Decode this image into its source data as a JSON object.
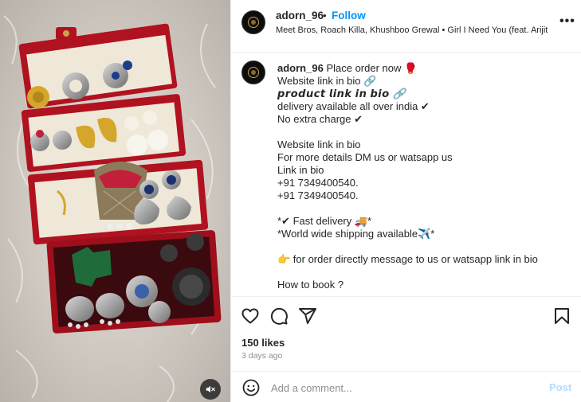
{
  "header": {
    "username": "adorn_96",
    "separator": "•",
    "follow_label": "Follow",
    "audio": "Meet Bros, Roach Killa, Khushboo Grewal • Girl I Need You (feat. Arijit ...",
    "more_label": "•••"
  },
  "caption": {
    "username": "adorn_96",
    "first_line": "Place order now 🥊",
    "lines": [
      "Website link in bio 🔗",
      "𝙥𝙧𝙤𝙙𝙪𝙘𝙩 𝙡𝙞𝙣𝙠 𝙞𝙣 𝙗𝙞𝙤 🔗",
      "delivery available all over india ✔",
      "No extra charge ✔",
      "",
      "Website link in bio",
      "For more details DM us or watsapp us",
      "Link in bio",
      "+91 7349400540.",
      "+91 7349400540.",
      "",
      "*✔ Fast delivery 🚚*",
      "*World wide shipping available✈️*",
      "",
      "👉 for order directly message to us or watsapp link in bio",
      "",
      "How to book ?"
    ]
  },
  "actions": {
    "like_icon": "heart-icon",
    "comment_icon": "comment-icon",
    "share_icon": "paper-plane-icon",
    "save_icon": "bookmark-icon"
  },
  "stats": {
    "likes": "150 likes",
    "date": "3 days ago"
  },
  "comment_bar": {
    "placeholder": "Add a comment...",
    "post_label": "Post",
    "emoji_icon": "smiley-icon"
  },
  "media": {
    "mute_icon": "speaker-muted-icon"
  },
  "colors": {
    "link_blue": "#0095f6",
    "post_disabled": "#b3dbff",
    "check_green": "#2ea12e",
    "muted_text": "#8e8e8e",
    "divider": "#efefef"
  }
}
